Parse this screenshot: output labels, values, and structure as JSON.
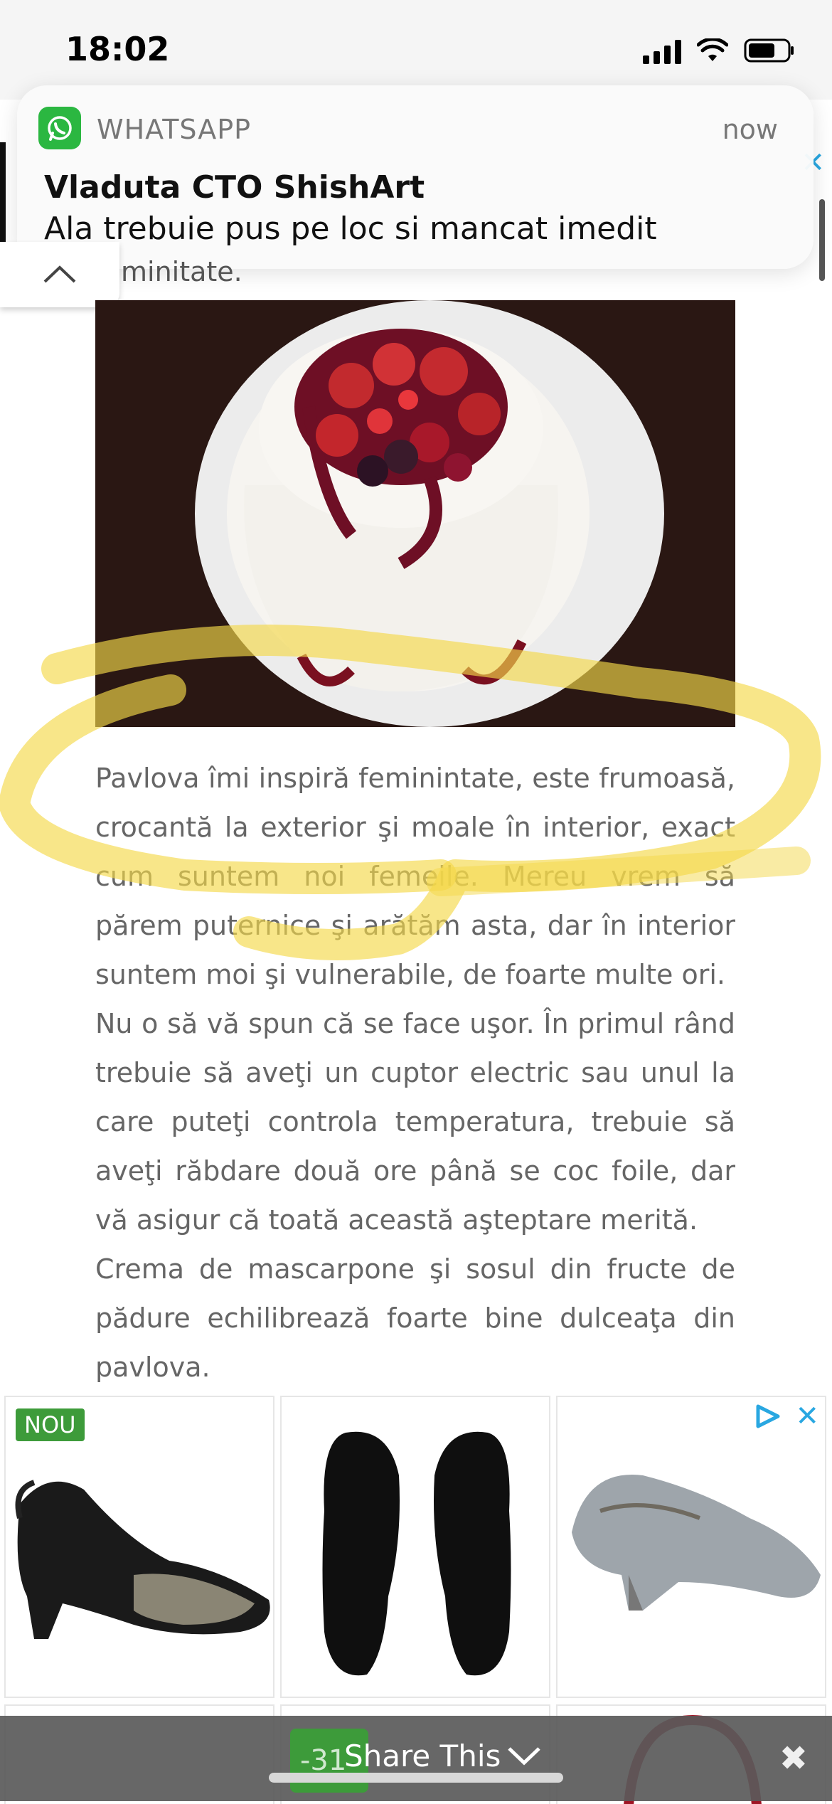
{
  "status_bar": {
    "time": "18:02"
  },
  "notification": {
    "app": "WHATSAPP",
    "time": "now",
    "sender": "Vladuta CTO ShishArt",
    "message": "Ala trebuie pus pe loc si mancat imedit"
  },
  "article": {
    "prev_line_fragment": "minitate.",
    "image_alt": "Pavlova cake with red berries",
    "paragraphs": [
      "Pavlova îmi inspiră feminintate, este frumoasă, crocantă la exterior şi moale în interior, exact cum suntem noi femeile. Mereu vrem să părem puternice şi arătăm asta, dar în interior suntem moi şi vulnerabile, de foarte multe ori.",
      "Nu o să vă spun că se face uşor. În primul rând trebuie să aveţi un cuptor electric sau unul la care puteţi controla temperatura, trebuie să aveţi răbdare două ore până se coc foile, dar vă asigur că toată această aşteptare merită.",
      "Crema de mascarpone şi sosul din fructe de pădure echilibrează foarte bine dulceaţa din pavlova."
    ]
  },
  "ad": {
    "badge": "NOU",
    "items": [
      "black slingback sandal",
      "black insoles",
      "snakeskin pump"
    ],
    "discount_fragment": "-31"
  },
  "share_bar": {
    "label": "Share This"
  },
  "colors": {
    "whatsapp_green": "#2bb741",
    "highlight_yellow": "#f4d84a",
    "badge_green": "#3d9b3a"
  }
}
